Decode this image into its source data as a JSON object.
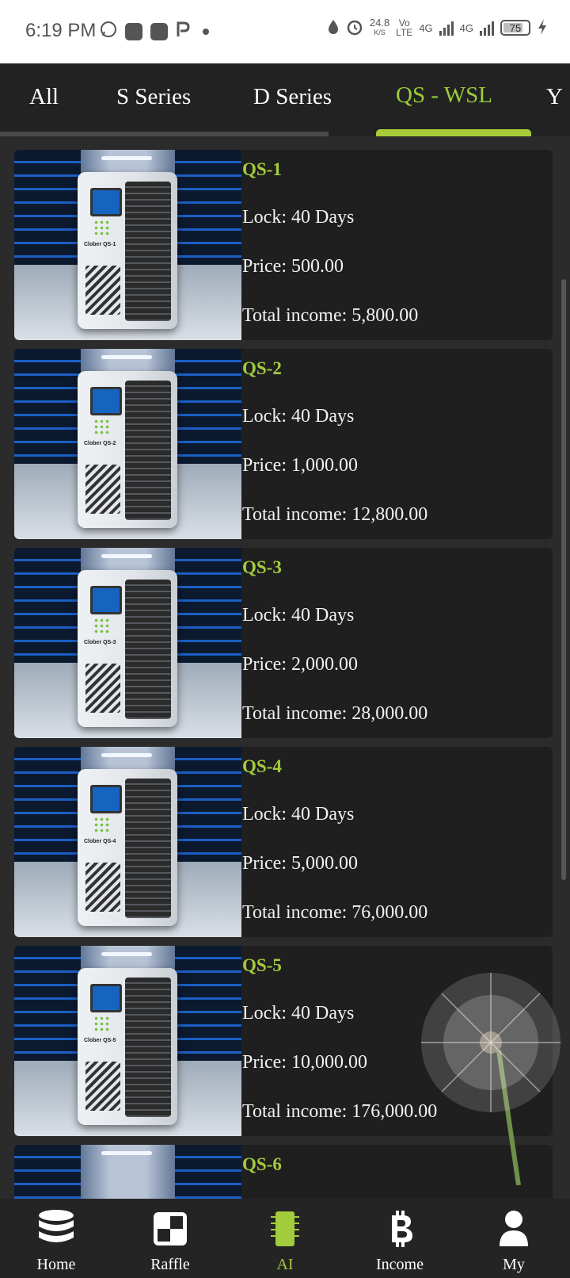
{
  "status_bar": {
    "time": "6:19 PM",
    "net_speed_value": "24.8",
    "net_speed_unit": "K/S",
    "volte_top": "Vo",
    "volte_bottom": "LTE",
    "sim1": "4G",
    "sim2": "4G",
    "battery": "75"
  },
  "tabs": [
    {
      "label": "All"
    },
    {
      "label": "S Series"
    },
    {
      "label": "D Series"
    },
    {
      "label": "QS - WSL"
    },
    {
      "label": "Y"
    }
  ],
  "active_tab": "QS - WSL",
  "products": [
    {
      "name": "QS-1",
      "image_label": "Clober QS-1",
      "lock": "Lock: 40 Days",
      "price": "Price: 500.00",
      "income": "Total income: 5,800.00"
    },
    {
      "name": "QS-2",
      "image_label": "Clober QS-2",
      "lock": "Lock: 40 Days",
      "price": "Price: 1,000.00",
      "income": "Total income: 12,800.00"
    },
    {
      "name": "QS-3",
      "image_label": "Clober QS-3",
      "lock": "Lock: 40 Days",
      "price": "Price: 2,000.00",
      "income": "Total income: 28,000.00"
    },
    {
      "name": "QS-4",
      "image_label": "Clober QS-4",
      "lock": "Lock: 40 Days",
      "price": "Price: 5,000.00",
      "income": "Total income: 76,000.00"
    },
    {
      "name": "QS-5",
      "image_label": "Clober QS-5",
      "lock": "Lock: 40 Days",
      "price": "Price: 10,000.00",
      "income": "Total income: 176,000.00"
    },
    {
      "name": "QS-6",
      "image_label": "",
      "lock": "",
      "price": "",
      "income": ""
    }
  ],
  "nav": [
    {
      "label": "Home",
      "icon": "database-icon"
    },
    {
      "label": "Raffle",
      "icon": "raffle-icon"
    },
    {
      "label": "AI",
      "icon": "chip-icon"
    },
    {
      "label": "Income",
      "icon": "bitcoin-icon"
    },
    {
      "label": "My",
      "icon": "user-icon"
    }
  ],
  "colors": {
    "accent": "#a2cc3c",
    "background": "#2b2b2b",
    "card": "#1f1f1f",
    "tabbar": "#222222"
  }
}
